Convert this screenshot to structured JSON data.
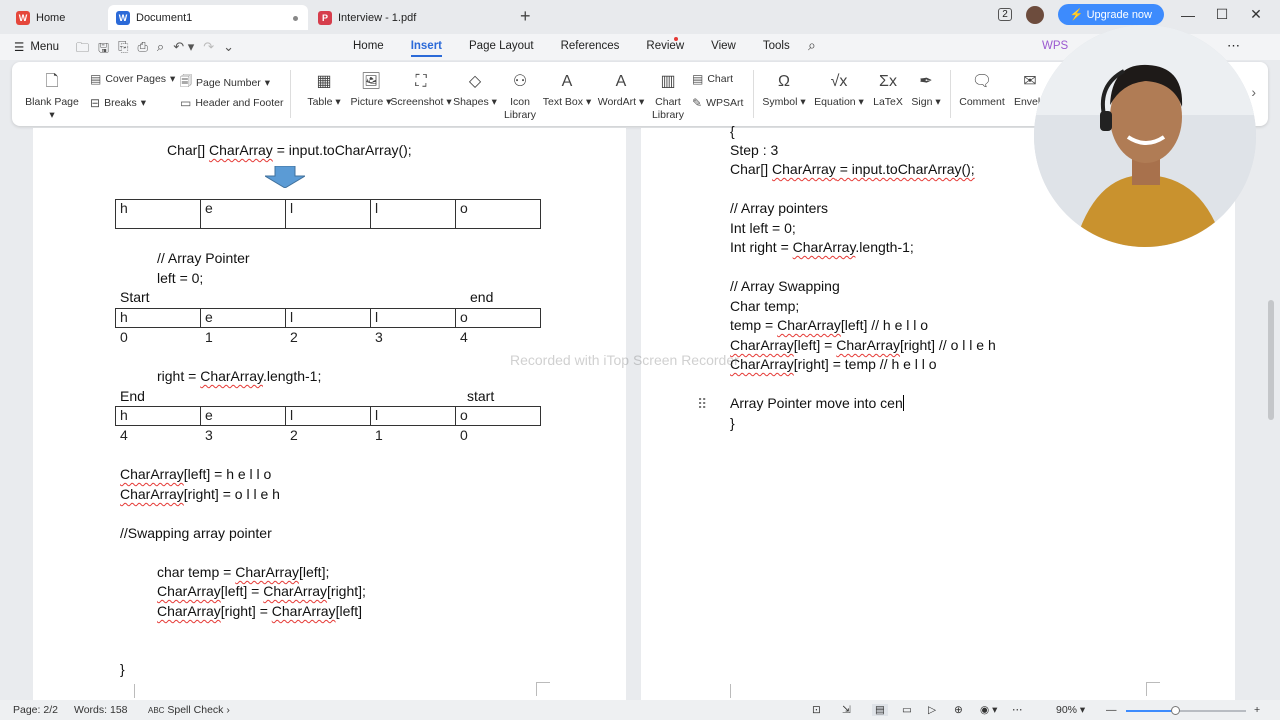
{
  "titlebar": {
    "tabs": [
      {
        "label": "Home",
        "logo_color": "#e5473b"
      },
      {
        "label": "Document1",
        "logo": "W",
        "logo_color": "#2b6ad8"
      },
      {
        "label": "Interview - 1.pdf",
        "logo": "P",
        "logo_color": "#d63d4c"
      }
    ],
    "upgrade_label": "Upgrade now",
    "account_badge": "2"
  },
  "menubar": {
    "menu_label": "Menu",
    "tabs": [
      "Home",
      "Insert",
      "Page Layout",
      "References",
      "Review",
      "View",
      "Tools"
    ],
    "active_tab": "Insert",
    "wps_ai_label": "WPS"
  },
  "ribbon": {
    "blank_page": "Blank Page",
    "cover_pages": "Cover Pages",
    "breaks": "Breaks",
    "page_number": "Page Number",
    "header_footer": "Header and Footer",
    "table": "Table",
    "picture": "Picture",
    "screenshot": "Screenshot",
    "shapes": "Shapes",
    "icon_library": [
      "Icon",
      "Library"
    ],
    "text_box": "Text Box",
    "wordart": "WordArt",
    "chart": "Chart",
    "chart_library": [
      "Chart",
      "Library"
    ],
    "wpsart": "WPSArt",
    "symbol": "Symbol",
    "equation": "Equation",
    "latex": "LaTeX",
    "sign": "Sign",
    "comment": "Comment",
    "envelope": "Envelo"
  },
  "left_page": {
    "line1_pre": "Char[] ",
    "line1_sq": "CharArray",
    "line1_post": " = input.toCharArray();",
    "array1": [
      "h",
      "e",
      "l",
      "l",
      "o"
    ],
    "comment_pointer": "// Array Pointer",
    "left_assign": "left = 0;",
    "label_start": "Start",
    "label_end": "end",
    "array2": [
      "h",
      "e",
      "l",
      "l",
      "o"
    ],
    "indices2": [
      "0",
      "1",
      "2",
      "3",
      "4"
    ],
    "right_assign_post": " = CharArray.length-1;",
    "right_assign_pre": "right",
    "label_end2": "End",
    "label_start2": "start",
    "array3": [
      "h",
      "e",
      "l",
      "l",
      "o"
    ],
    "indices3": [
      "4",
      "3",
      "2",
      "1",
      "0"
    ],
    "left_eq": "[left] = h e l l o",
    "right_eq": "[right] = o l l e h",
    "charray": "CharArray",
    "swap_comment": "//Swapping array pointer",
    "swap1_pre": "char temp = ",
    "swap1_post": "[left];",
    "swap2_mid": "[left] = ",
    "swap2_post": "[right];",
    "swap3_mid": "[right] = ",
    "swap3_post": "[left]",
    "close_brace": "}"
  },
  "right_page": {
    "open_brace": "{",
    "step": "Step : 3",
    "line_chararray_pre": "Char[] ",
    "line_chararray_post": " = input.toCharArray();",
    "comment_pointers": "// Array pointers",
    "int_left": "Int left = 0;",
    "int_right_pre": "Int right = ",
    "int_right_post": ".length-1;",
    "comment_swapping": "// Array Swapping",
    "char_temp": "Char temp;",
    "temp_assign_pre": "temp = ",
    "temp_assign_post": "[left] // h e l l o",
    "left_swap_mid": "[left] = ",
    "left_swap_post": "[right] // o l l e h",
    "right_swap_post": "[right] = temp // h e l l o",
    "typing_line": "Array Pointer move into cen",
    "close_brace": "}",
    "charray": "CharArray"
  },
  "watermark": "Recorded with iTop Screen Recorder",
  "statusbar": {
    "page": "Page: 2/2",
    "words": "Words: 158",
    "spell_check": "Spell Check",
    "zoom": "90%"
  }
}
